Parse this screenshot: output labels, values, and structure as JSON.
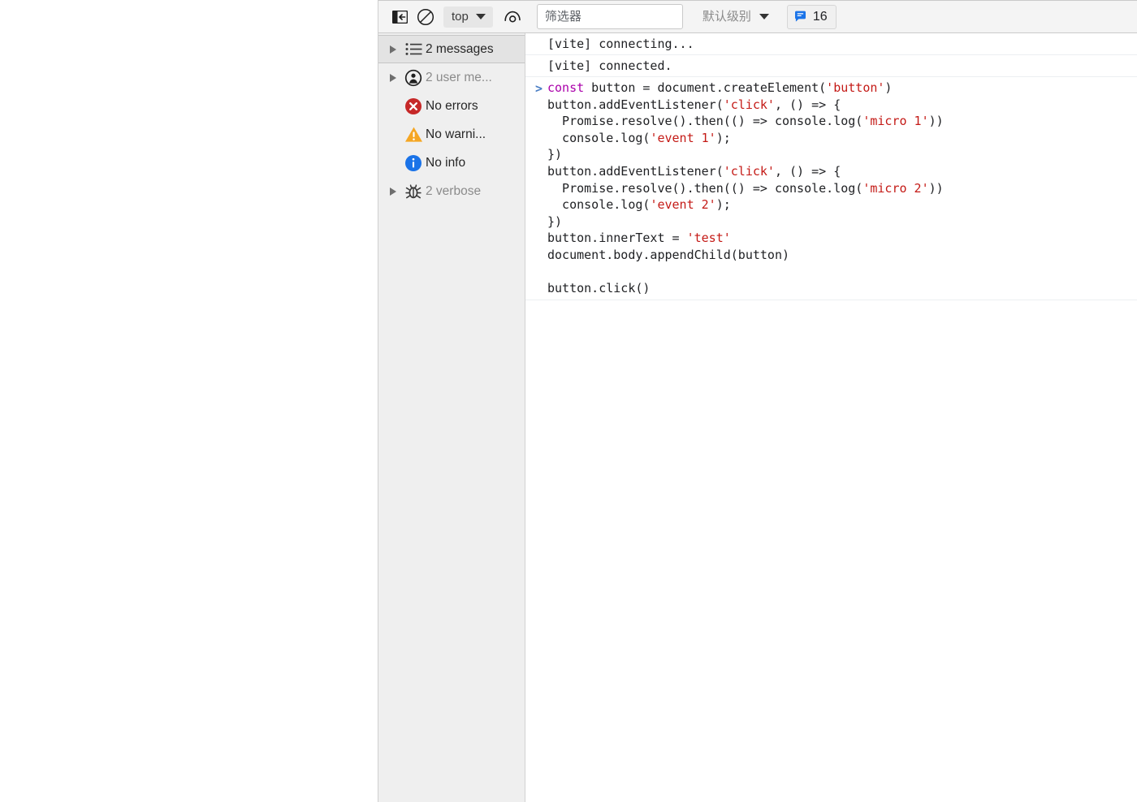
{
  "toolbar": {
    "sidebar_toggle_tooltip": "Show console sidebar",
    "clear_console_tooltip": "Clear console",
    "context_label": "top",
    "eye_tooltip": "Create live expression",
    "filter_placeholder": "筛选器",
    "filter_value": "",
    "level_label": "默认级别",
    "issues_count": "16"
  },
  "sidebar": {
    "items": [
      {
        "label": "2 messages",
        "icon": "list-icon",
        "expandable": true,
        "selected": true,
        "muted": false
      },
      {
        "label": "2 user me...",
        "icon": "user-message-icon",
        "expandable": true,
        "selected": false,
        "muted": true
      },
      {
        "label": "No errors",
        "icon": "error-icon",
        "expandable": false,
        "selected": false,
        "muted": false
      },
      {
        "label": "No warni...",
        "icon": "warning-icon",
        "expandable": false,
        "selected": false,
        "muted": false
      },
      {
        "label": "No info",
        "icon": "info-icon",
        "expandable": false,
        "selected": false,
        "muted": false
      },
      {
        "label": "2 verbose",
        "icon": "bug-icon",
        "expandable": true,
        "selected": false,
        "muted": true
      }
    ]
  },
  "console": {
    "messages": [
      {
        "text": "[vite] connecting..."
      },
      {
        "text": "[vite] connected."
      }
    ],
    "command": {
      "prompt": ">",
      "lines": [
        [
          {
            "t": "const",
            "c": "kw"
          },
          {
            "t": " button = document.createElement(",
            "c": "plain"
          },
          {
            "t": "'button'",
            "c": "str"
          },
          {
            "t": ")",
            "c": "plain"
          }
        ],
        [
          {
            "t": "button.addEventListener(",
            "c": "plain"
          },
          {
            "t": "'click'",
            "c": "str"
          },
          {
            "t": ", () => {",
            "c": "plain"
          }
        ],
        [
          {
            "t": "  Promise.resolve().then(() => console.log(",
            "c": "plain"
          },
          {
            "t": "'micro 1'",
            "c": "str"
          },
          {
            "t": "))",
            "c": "plain"
          }
        ],
        [
          {
            "t": "  console.log(",
            "c": "plain"
          },
          {
            "t": "'event 1'",
            "c": "str"
          },
          {
            "t": ");",
            "c": "plain"
          }
        ],
        [
          {
            "t": "})",
            "c": "plain"
          }
        ],
        [
          {
            "t": "button.addEventListener(",
            "c": "plain"
          },
          {
            "t": "'click'",
            "c": "str"
          },
          {
            "t": ", () => {",
            "c": "plain"
          }
        ],
        [
          {
            "t": "  Promise.resolve().then(() => console.log(",
            "c": "plain"
          },
          {
            "t": "'micro 2'",
            "c": "str"
          },
          {
            "t": "))",
            "c": "plain"
          }
        ],
        [
          {
            "t": "  console.log(",
            "c": "plain"
          },
          {
            "t": "'event 2'",
            "c": "str"
          },
          {
            "t": ");",
            "c": "plain"
          }
        ],
        [
          {
            "t": "})",
            "c": "plain"
          }
        ],
        [
          {
            "t": "button.innerText = ",
            "c": "plain"
          },
          {
            "t": "'test'",
            "c": "str"
          }
        ],
        [
          {
            "t": "document.body.appendChild(button)",
            "c": "plain"
          }
        ],
        [
          {
            "t": "",
            "c": "plain"
          }
        ],
        [
          {
            "t": "button.click()",
            "c": "plain"
          }
        ]
      ]
    }
  },
  "colors": {
    "toolbar_bg": "#f4f4f4",
    "sidebar_bg": "#efefef",
    "selected_row_bg": "#e3e3e3",
    "error_red": "#c62828",
    "warning_orange": "#f5a623",
    "info_blue": "#1a73e8",
    "issues_blue": "#1a73e8",
    "string_red": "#c41a16",
    "keyword_purple": "#aa00aa",
    "prompt_blue": "#4a7ec4"
  }
}
